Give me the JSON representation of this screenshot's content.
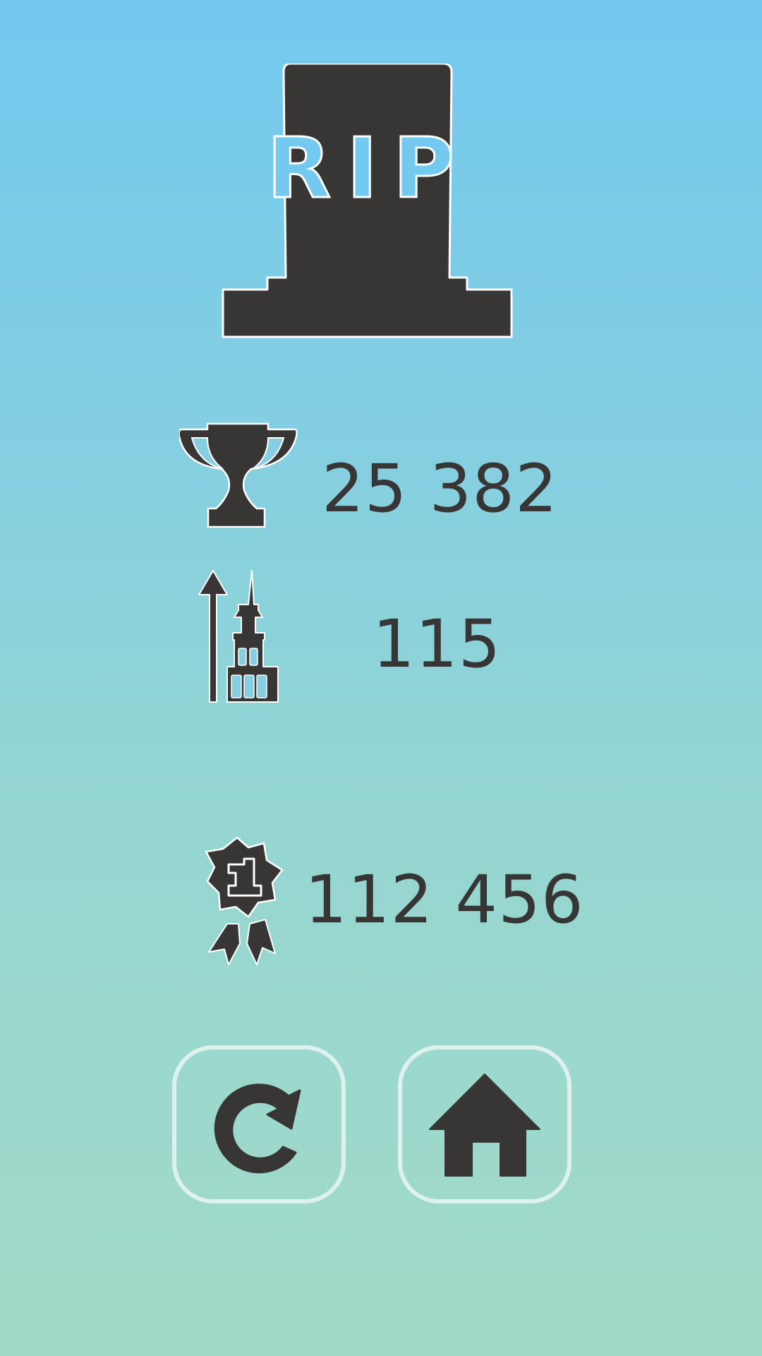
{
  "tombstone": {
    "text": "RIP",
    "color": "#383634",
    "letter_color": "#73c9ef"
  },
  "stats": {
    "score": {
      "icon": "trophy-icon",
      "value": "25 382"
    },
    "height": {
      "icon": "building-height-icon",
      "value": "115"
    },
    "best": {
      "icon": "first-place-badge-icon",
      "value": "112 456",
      "badge_number": "1"
    }
  },
  "buttons": {
    "restart": {
      "icon": "restart-icon"
    },
    "home": {
      "icon": "home-icon"
    }
  },
  "colors": {
    "dark": "#383634",
    "button_border": "#dff1ec",
    "bg_top": "#73c9ef",
    "bg_bottom": "#a2dac7"
  }
}
